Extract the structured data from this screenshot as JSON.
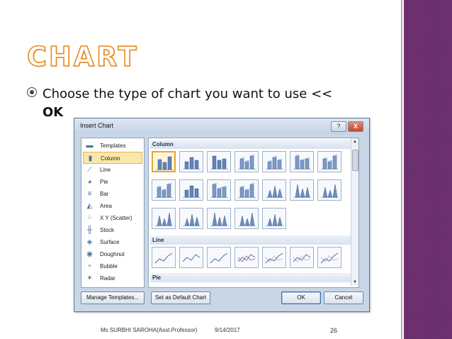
{
  "slide": {
    "title": "CHART",
    "bullet_text": "Choose the type of chart you want to use <<",
    "bullet_ok": "OK",
    "footer_author": "Ms SURBHI SAROHA(Asst.Professor)",
    "footer_date": "9/14/2017",
    "footer_page": "26",
    "accent_color": "#e68a1e",
    "band_color": "#6b2c6e"
  },
  "dialog": {
    "title": "Insert Chart",
    "help_button": "?",
    "close_button": "X",
    "categories": [
      {
        "label": "Templates",
        "icon": "folder-icon"
      },
      {
        "label": "Column",
        "icon": "column-chart-icon",
        "selected": true
      },
      {
        "label": "Line",
        "icon": "line-chart-icon"
      },
      {
        "label": "Pie",
        "icon": "pie-chart-icon"
      },
      {
        "label": "Bar",
        "icon": "bar-chart-icon"
      },
      {
        "label": "Area",
        "icon": "area-chart-icon"
      },
      {
        "label": "X Y (Scatter)",
        "icon": "scatter-chart-icon"
      },
      {
        "label": "Stock",
        "icon": "stock-chart-icon"
      },
      {
        "label": "Surface",
        "icon": "surface-chart-icon"
      },
      {
        "label": "Doughnut",
        "icon": "doughnut-chart-icon"
      },
      {
        "label": "Bubble",
        "icon": "bubble-chart-icon"
      },
      {
        "label": "Radar",
        "icon": "radar-chart-icon"
      }
    ],
    "sections": {
      "column": "Column",
      "line": "Line",
      "pie": "Pie"
    },
    "buttons": {
      "manage_templates": "Manage Templates...",
      "set_default": "Set as Default Chart",
      "ok": "OK",
      "cancel": "Cancel"
    }
  }
}
